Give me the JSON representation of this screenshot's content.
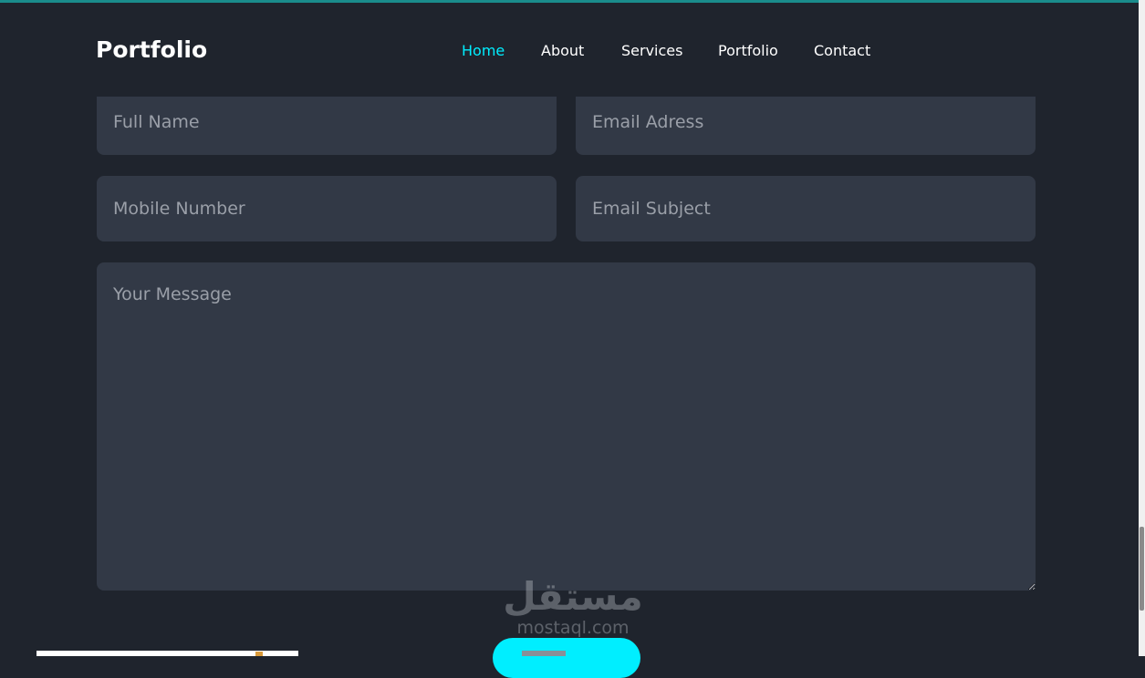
{
  "header": {
    "logo": "Portfolio",
    "nav": [
      {
        "label": "Home",
        "active": true
      },
      {
        "label": "About",
        "active": false
      },
      {
        "label": "Services",
        "active": false
      },
      {
        "label": "Portfolio",
        "active": false
      },
      {
        "label": "Contact",
        "active": false
      }
    ]
  },
  "form": {
    "full_name_placeholder": "Full Name",
    "email_placeholder": "Email Adress",
    "mobile_placeholder": "Mobile Number",
    "subject_placeholder": "Email Subject",
    "message_placeholder": "Your Message"
  },
  "watermark": {
    "arabic": "مستقل",
    "latin": "mostaql.com"
  },
  "colors": {
    "background": "#1f242d",
    "field": "#323946",
    "accent": "#00eeff",
    "text": "#ffffff"
  }
}
